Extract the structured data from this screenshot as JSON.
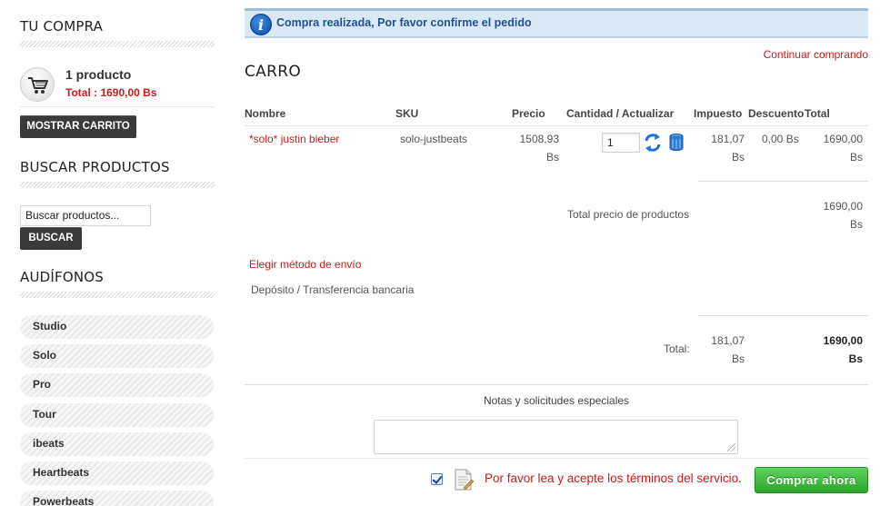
{
  "sidebar": {
    "cart_heading": "TU COMPRA",
    "cart_count": "1 producto",
    "cart_total": "Total : 1690,00 Bs",
    "show_cart_label": "MOSTRAR CARRITO",
    "search_heading": "BUSCAR PRODUCTOS",
    "search_value": "Buscar productos...",
    "search_button": "BUSCAR",
    "category_heading": "AUDÍFONOS",
    "categories": [
      "Studio",
      "Solo",
      "Pro",
      "Tour",
      "ibeats",
      "Heartbeats",
      "Powerbeats"
    ]
  },
  "alert": {
    "icon": "info-icon",
    "message": "Compra realizada, Por favor confirme el pedido"
  },
  "main": {
    "continue_link": "Continuar comprando",
    "title": "CARRO"
  },
  "table": {
    "headers": {
      "name": "Nombre",
      "sku": "SKU",
      "price": "Precio",
      "qty": "Cantidad / Actualizar",
      "tax": "Impuesto",
      "discount": "Descuento",
      "total": "Total"
    },
    "row": {
      "name": "*solo* justin bieber",
      "sku": "solo-justbeats",
      "price": "1508,93",
      "price_currency": "Bs",
      "qty": "1",
      "tax": "181,07",
      "tax_currency": "Bs",
      "discount": "0,00 Bs",
      "total": "1690,00",
      "total_currency": "Bs"
    },
    "products_total_label": "Total precio de productos",
    "products_total": "1690,00",
    "products_total_currency": "Bs",
    "shipping_link": "Elegir método de envío",
    "payment_method": "Depósito / Transferencia bancaria",
    "grand_label": "Total:",
    "grand_tax": "181,07",
    "grand_tax_currency": "Bs",
    "grand_total": "1690,00",
    "grand_total_currency": "Bs"
  },
  "notes": {
    "label": "Notas y solicitudes especiales",
    "value": ""
  },
  "checkout": {
    "terms_text": "Por favor lea y acepte los términos del servicio.",
    "buy_label": "Comprar ahora",
    "terms_checked": true
  },
  "colors": {
    "accent_red": "#c51c1c",
    "alert_blue": "#1b5396",
    "buy_green": "#2aa52a",
    "dark_button": "#3a3a3a"
  }
}
